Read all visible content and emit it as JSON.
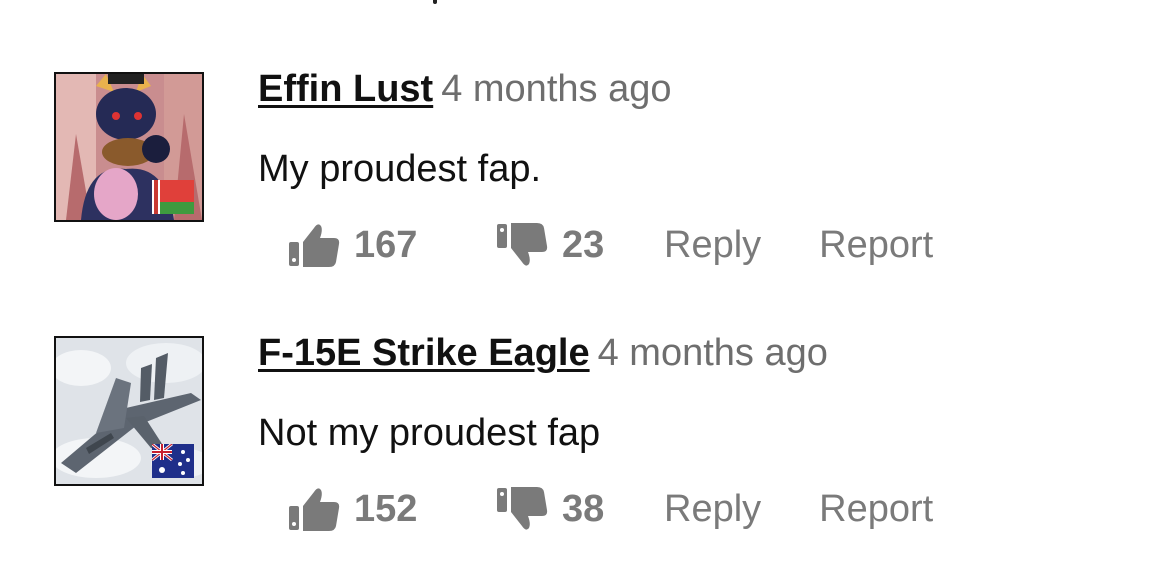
{
  "comments": [
    {
      "username": "Effin Lust",
      "timestamp": "4 months ago",
      "text": "My proudest fap.",
      "likes": "167",
      "dislikes": "23",
      "reply_label": "Reply",
      "report_label": "Report",
      "avatar": "furry-character-avatar",
      "flag": "belarus-flag-icon"
    },
    {
      "username": "F-15E Strike Eagle",
      "timestamp": "4 months ago",
      "text": "Not my proudest fap",
      "likes": "152",
      "dislikes": "38",
      "reply_label": "Reply",
      "report_label": "Report",
      "avatar": "fighter-jet-avatar",
      "flag": "australia-flag-icon"
    }
  ],
  "colors": {
    "username": "#111111",
    "meta": "#6e6e6e",
    "actions": "#7a7a7a",
    "background": "#ffffff"
  }
}
